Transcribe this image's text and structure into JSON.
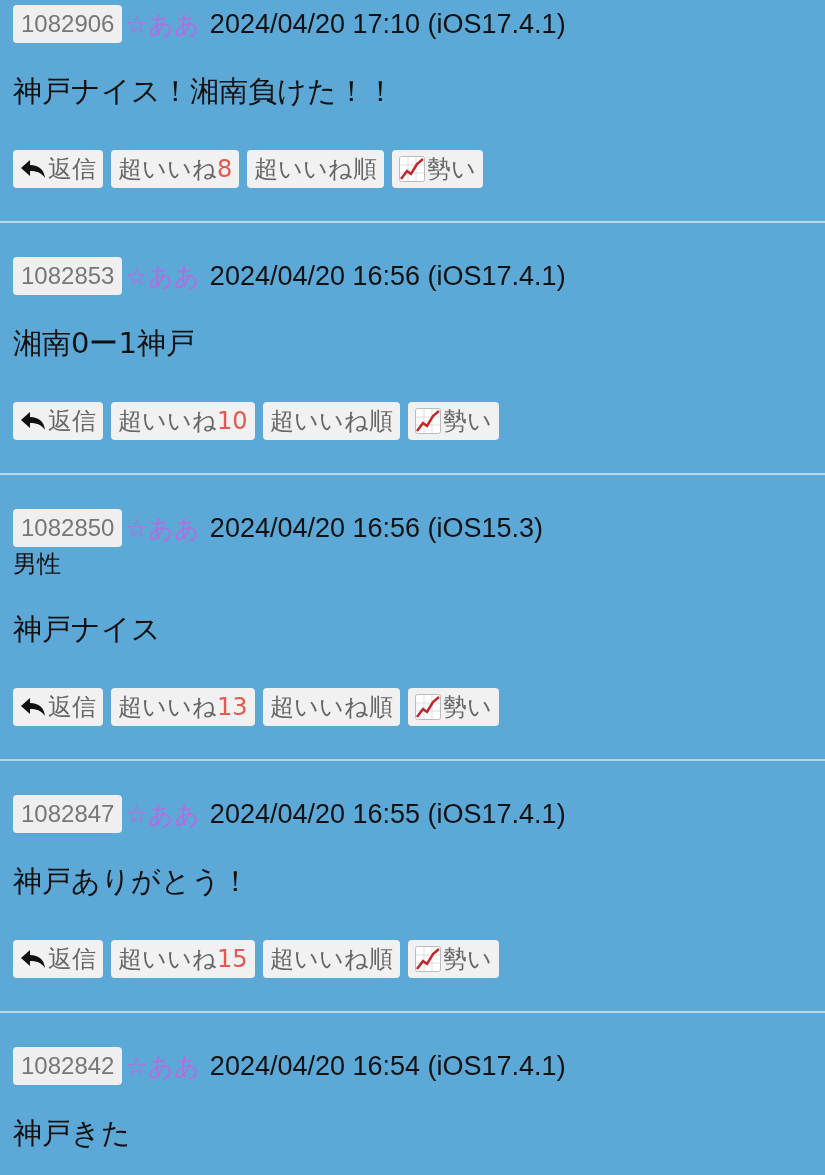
{
  "posts": [
    {
      "number": "1082906",
      "name": "☆ああ",
      "datetime": "2024/04/20 17:10 (iOS17.4.1)",
      "body": "神戸ナイス！湘南負けた！！",
      "actions": [
        {
          "kind": "reply",
          "label": "返信"
        },
        {
          "kind": "like",
          "label": "超いいね",
          "count": "8"
        },
        {
          "kind": "sort",
          "label": "超いいね順"
        },
        {
          "kind": "trend",
          "label": "勢い"
        }
      ]
    },
    {
      "number": "1082853",
      "name": "☆ああ",
      "datetime": "2024/04/20 16:56 (iOS17.4.1)",
      "body": "湘南0ー1神戸",
      "actions": [
        {
          "kind": "reply",
          "label": "返信"
        },
        {
          "kind": "like",
          "label": "超いいね",
          "count": "10"
        },
        {
          "kind": "sort",
          "label": "超いいね順"
        },
        {
          "kind": "trend",
          "label": "勢い"
        }
      ]
    },
    {
      "number": "1082850",
      "name": "☆ああ",
      "datetime": "2024/04/20 16:56 (iOS15.3)",
      "gender": "男性",
      "body": "神戸ナイス",
      "actions": [
        {
          "kind": "reply",
          "label": "返信"
        },
        {
          "kind": "like",
          "label": "超いいね",
          "count": "13"
        },
        {
          "kind": "sort",
          "label": "超いいね順"
        },
        {
          "kind": "trend",
          "label": "勢い"
        }
      ]
    },
    {
      "number": "1082847",
      "name": "☆ああ",
      "datetime": "2024/04/20 16:55 (iOS17.4.1)",
      "body": "神戸ありがとう！",
      "actions": [
        {
          "kind": "reply",
          "label": "返信"
        },
        {
          "kind": "like",
          "label": "超いいね",
          "count": "15"
        },
        {
          "kind": "sort",
          "label": "超いいね順"
        },
        {
          "kind": "trend",
          "label": "勢い"
        }
      ]
    },
    {
      "number": "1082842",
      "name": "☆ああ",
      "datetime": "2024/04/20 16:54 (iOS17.4.1)",
      "body": "神戸きた"
    }
  ]
}
